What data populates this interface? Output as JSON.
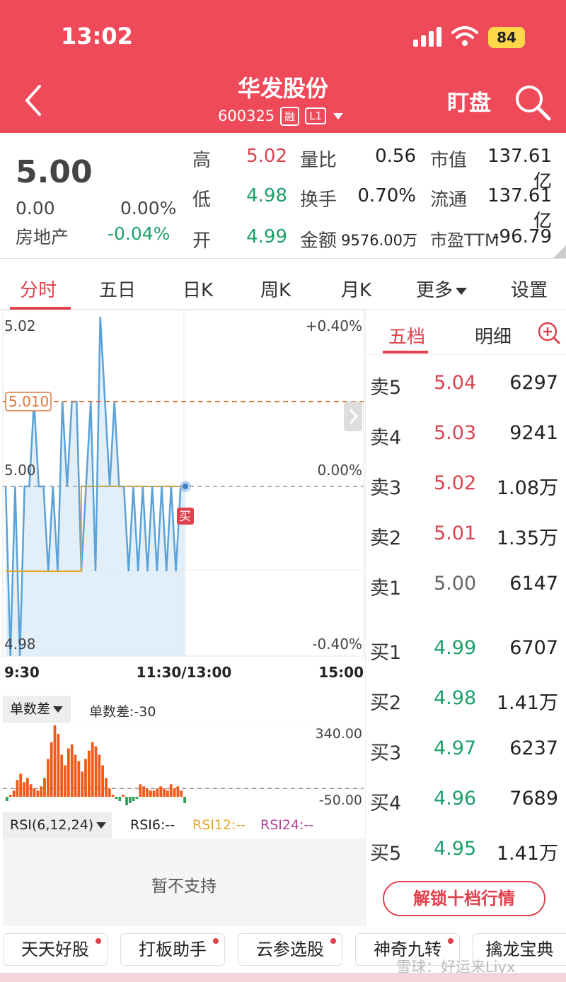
{
  "status_bar": {
    "time": "13:02",
    "battery": "84"
  },
  "header": {
    "title": "华发股份",
    "code": "600325",
    "tag1": "融",
    "tag2": "L1",
    "watch_label": "盯盘"
  },
  "quote": {
    "price": "5.00",
    "change": "0.00",
    "change_pct": "0.00%",
    "sector": "房地产",
    "sector_pct": "-0.04%",
    "high_label": "高",
    "high": "5.02",
    "low_label": "低",
    "low": "4.98",
    "open_label": "开",
    "open": "4.99",
    "vol_ratio_label": "量比",
    "vol_ratio": "0.56",
    "turnover_label": "换手",
    "turnover": "0.70%",
    "amount_label": "金额",
    "amount": "9576.00万",
    "mktcap_label": "市值",
    "mktcap": "137.61亿",
    "float_label": "流通",
    "float": "137.61亿",
    "pe_label": "市盈TTM",
    "pe": "-96.79"
  },
  "tabs": [
    "分时",
    "五日",
    "日K",
    "周K",
    "月K",
    "更多",
    "设置"
  ],
  "chart": {
    "y_top": "5.02",
    "y_mid": "5.00",
    "y_bot": "4.98",
    "pct_top": "+0.40%",
    "pct_mid": "0.00%",
    "pct_bot": "-0.40%",
    "avg_label": "5.010",
    "buy_marker": "买",
    "x_start": "9:30",
    "x_mid": "11:30/13:00",
    "x_end": "15:00"
  },
  "chart_data": [
    {
      "type": "line",
      "title": "分时",
      "x_ticks": [
        "9:30",
        "11:30/13:00",
        "15:00"
      ],
      "ylim": [
        4.98,
        5.02
      ],
      "reference": 5.0,
      "avg_marker": 5.01,
      "series": [
        {
          "values": [
            5.0,
            4.98,
            5.0,
            4.98,
            5.0,
            5.0,
            5.01,
            5.0,
            5.0,
            4.99,
            5.0,
            4.99,
            5.01,
            5.0,
            5.01,
            5.01,
            4.99,
            5.0,
            5.01,
            4.99,
            5.02,
            5.01,
            5.0,
            5.01,
            5.0,
            5.0,
            4.99,
            5.0,
            4.99,
            5.0,
            4.99,
            5.0,
            4.99,
            5.0,
            4.99,
            5.0,
            4.99,
            5.0,
            5.0
          ]
        },
        {
          "values": [
            4.99,
            4.99,
            4.99,
            4.99,
            4.99,
            4.99,
            4.99,
            4.99,
            4.99,
            4.99,
            4.99,
            4.99,
            4.99,
            4.99,
            4.99,
            4.99,
            5.0,
            5.0,
            5.0,
            5.0,
            5.0,
            5.0,
            5.0,
            5.0,
            5.0,
            5.0,
            5.0,
            5.0,
            5.0,
            5.0,
            5.0,
            5.0,
            5.0,
            5.0,
            5.0,
            5.0,
            5.0,
            5.0,
            5.0
          ]
        }
      ]
    },
    {
      "type": "bar",
      "title": "单数差",
      "ylim": [
        -50,
        340
      ],
      "y_ticks": [
        "340.00",
        "-50.00"
      ],
      "values": [
        -20,
        10,
        30,
        80,
        110,
        70,
        90,
        60,
        40,
        30,
        50,
        90,
        180,
        260,
        340,
        300,
        200,
        150,
        230,
        250,
        200,
        170,
        120,
        180,
        220,
        260,
        240,
        200,
        150,
        90,
        40,
        10,
        -10,
        -20,
        10,
        -40,
        -30,
        -20,
        -10,
        60,
        50,
        40,
        30,
        30,
        40,
        50,
        40,
        30,
        60,
        40,
        50,
        30,
        -30
      ]
    }
  ],
  "indicator": {
    "select": "单数差",
    "value": "单数差:-30"
  },
  "rsi": {
    "select": "RSI(6,12,24)",
    "rsi6": "RSI6:--",
    "rsi12": "RSI12:--",
    "rsi24": "RSI24:--",
    "empty": "暂不支持"
  },
  "side": {
    "tab_active": "五档",
    "tab2": "明细",
    "asks": [
      {
        "label": "卖5",
        "price": "5.04",
        "vol": "6297"
      },
      {
        "label": "卖4",
        "price": "5.03",
        "vol": "9241"
      },
      {
        "label": "卖3",
        "price": "5.02",
        "vol": "1.08万"
      },
      {
        "label": "卖2",
        "price": "5.01",
        "vol": "1.35万"
      },
      {
        "label": "卖1",
        "price": "5.00",
        "vol": "6147"
      }
    ],
    "bids": [
      {
        "label": "买1",
        "price": "4.99",
        "vol": "6707"
      },
      {
        "label": "买2",
        "price": "4.98",
        "vol": "1.41万"
      },
      {
        "label": "买3",
        "price": "4.97",
        "vol": "6237"
      },
      {
        "label": "买4",
        "price": "4.96",
        "vol": "7689"
      },
      {
        "label": "买5",
        "price": "4.95",
        "vol": "1.41万"
      }
    ],
    "unlock": "解锁十档行情"
  },
  "tools": [
    "天天好股",
    "打板助手",
    "云参选股",
    "神奇九转",
    "擒龙宝典"
  ],
  "watermark": "雪球：好运来Liyx",
  "colors": {
    "header": "#ee4a5a",
    "up": "#d9434f",
    "down": "#1da06a",
    "line": "#5aa2d8",
    "avg": "#e3a72a"
  }
}
